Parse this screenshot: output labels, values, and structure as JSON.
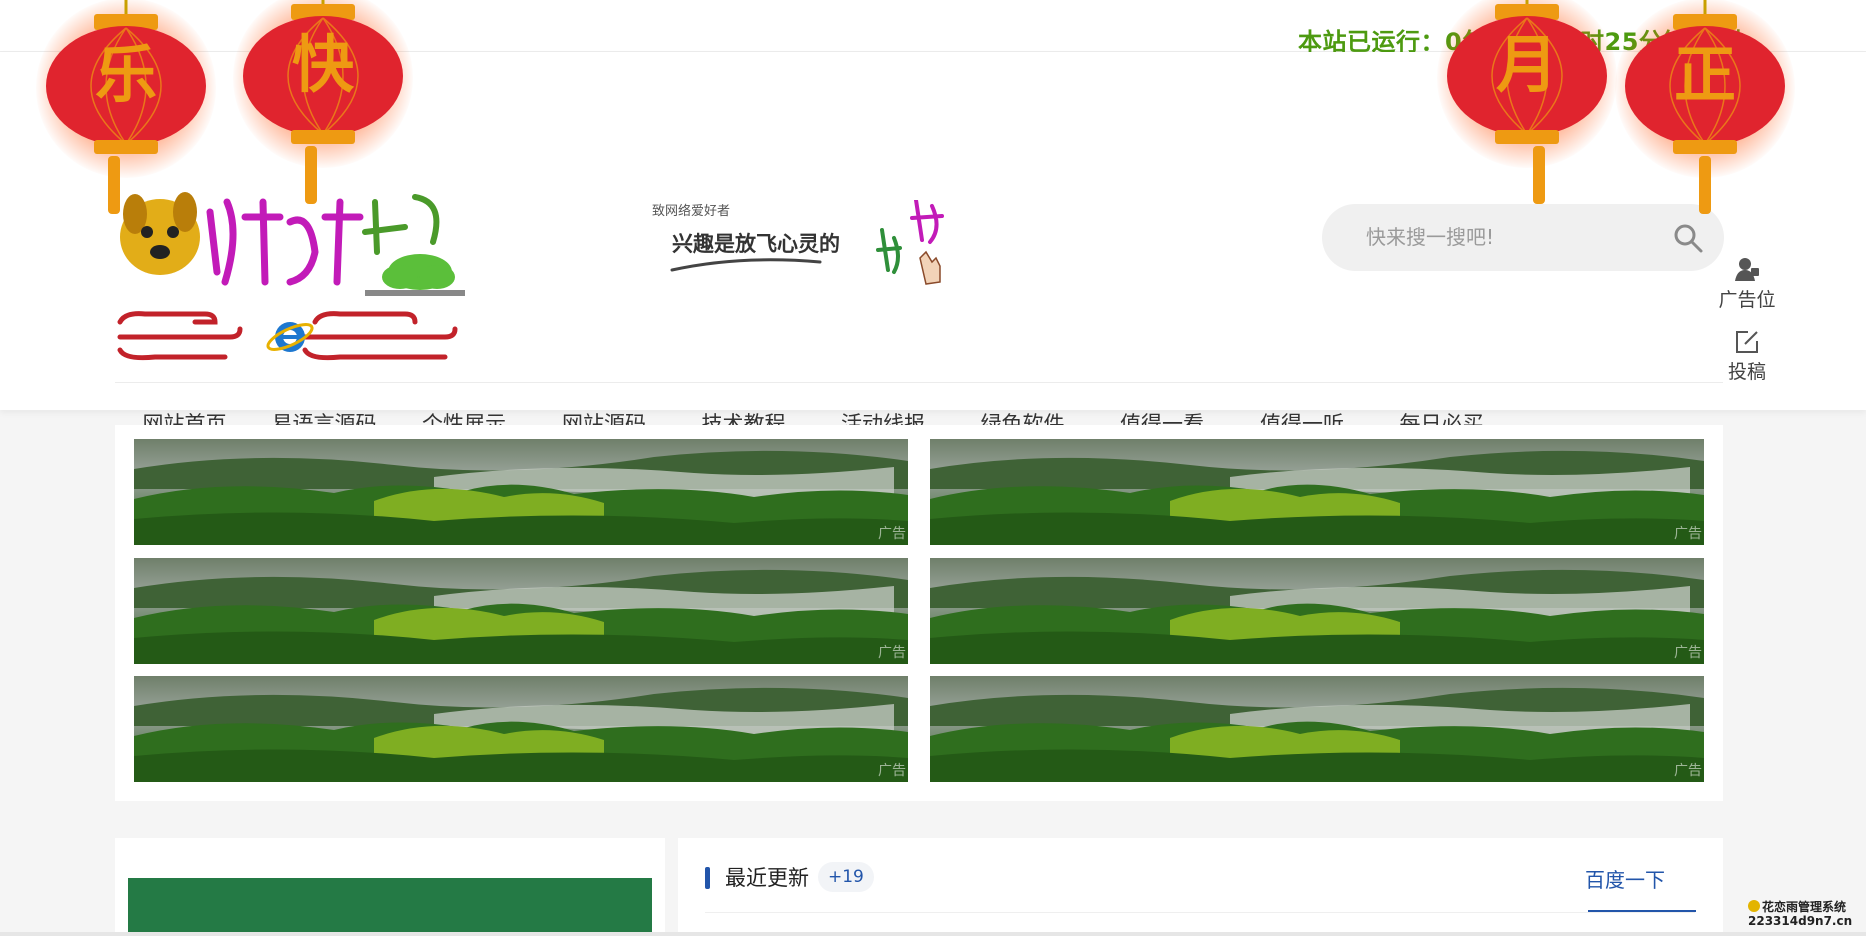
{
  "runtime_text": "本站已运行：0年360天2时25分钟59秒",
  "slogan": {
    "small": "致网络爱好者",
    "main": "兴趣是放飞心灵的"
  },
  "search": {
    "placeholder": "快来搜一搜吧!",
    "icon": "search-icon"
  },
  "side_tools": [
    {
      "label": "广告位",
      "icon": "user-icon"
    },
    {
      "label": "投稿",
      "icon": "edit-icon"
    }
  ],
  "nav": {
    "active_index": 0,
    "items": [
      "网站首页",
      "易语言源码",
      "个性展示",
      "网站源码",
      "技术教程",
      "活动线报",
      "绿色软件",
      "值得一看",
      "值得一听",
      "每日必买"
    ]
  },
  "ads": {
    "tag": "广告",
    "count": 6
  },
  "recent": {
    "title": "最近更新",
    "count": "+19",
    "link": "百度一下"
  },
  "lanterns": [
    "乐",
    "快",
    "月",
    "正"
  ],
  "watermark": {
    "line1": "花恋雨管理系统",
    "line2": "223314d9n7.cn"
  },
  "colors": {
    "accent": "#2255aa",
    "runtime": "#4d9a10",
    "lantern_red": "#e0242e",
    "lantern_gold": "#ee9a12"
  }
}
